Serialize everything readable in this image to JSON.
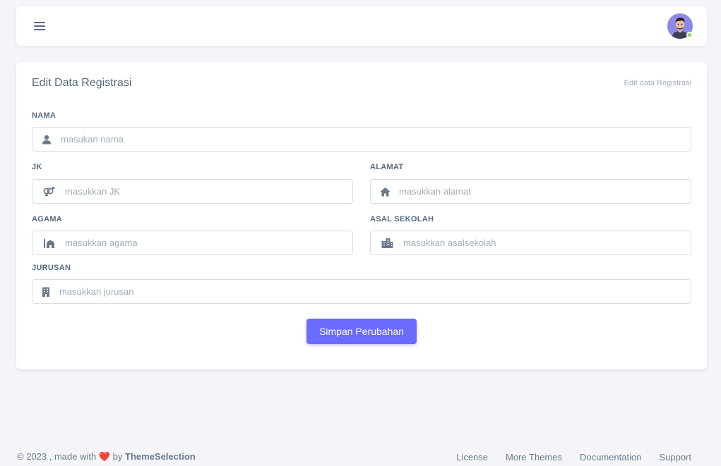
{
  "card": {
    "title": "Edit Data Registrasi",
    "subtitle": "Edit data Registrasi"
  },
  "form": {
    "nama": {
      "label": "NAMA",
      "placeholder": "masukan nama",
      "icon": "user-icon"
    },
    "jk": {
      "label": "JK",
      "placeholder": "masukkan JK",
      "icon": "gender-icon"
    },
    "alamat": {
      "label": "ALAMAT",
      "placeholder": "masukkan alamat",
      "icon": "home-icon"
    },
    "agama": {
      "label": "AGAMA",
      "placeholder": "masukkan agama",
      "icon": "mosque-icon"
    },
    "asal_sekolah": {
      "label": "ASAL SEKOLAH",
      "placeholder": "masukkan asalsekolah",
      "icon": "buildings-icon"
    },
    "jurusan": {
      "label": "JURUSAN",
      "placeholder": "masukkan jurusan",
      "icon": "building-icon"
    },
    "submit_label": "Simpan Perubahan"
  },
  "footer": {
    "copyright": "© 2023 , made with",
    "by": "by",
    "brand": "ThemeSelection",
    "links": [
      "License",
      "More Themes",
      "Documentation",
      "Support"
    ]
  },
  "colors": {
    "primary": "#696cff",
    "background": "#f5f5f9",
    "text": "#566a7f",
    "online": "#71dd37"
  }
}
